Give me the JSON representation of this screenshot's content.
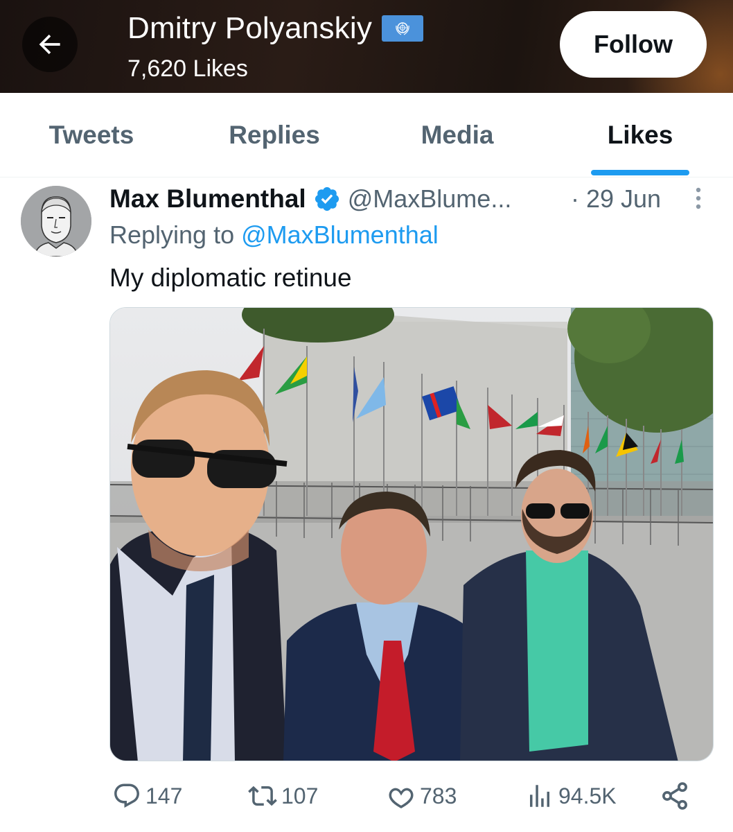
{
  "header": {
    "title": "Dmitry Polyanskiy",
    "subtitle": "7,620 Likes",
    "follow_label": "Follow",
    "back_icon": "arrow-left-icon",
    "flag_icon": "un-flag-icon"
  },
  "tabs": [
    {
      "label": "Tweets",
      "active": false
    },
    {
      "label": "Replies",
      "active": false
    },
    {
      "label": "Media",
      "active": false
    },
    {
      "label": "Likes",
      "active": true
    }
  ],
  "tweet": {
    "author": "Max Blumenthal",
    "handle": "@MaxBlume...",
    "date": "· 29 Jun",
    "replying_prefix": "Replying to ",
    "replying_handle": "@MaxBlumenthal",
    "text": "My diplomatic retinue",
    "photo_icon": "photo",
    "actions": {
      "replies": "147",
      "retweets": "107",
      "likes": "783",
      "views": "94.5K"
    }
  },
  "colors": {
    "accent": "#1d9bf0",
    "text": "#0f1419",
    "muted": "#536471"
  }
}
